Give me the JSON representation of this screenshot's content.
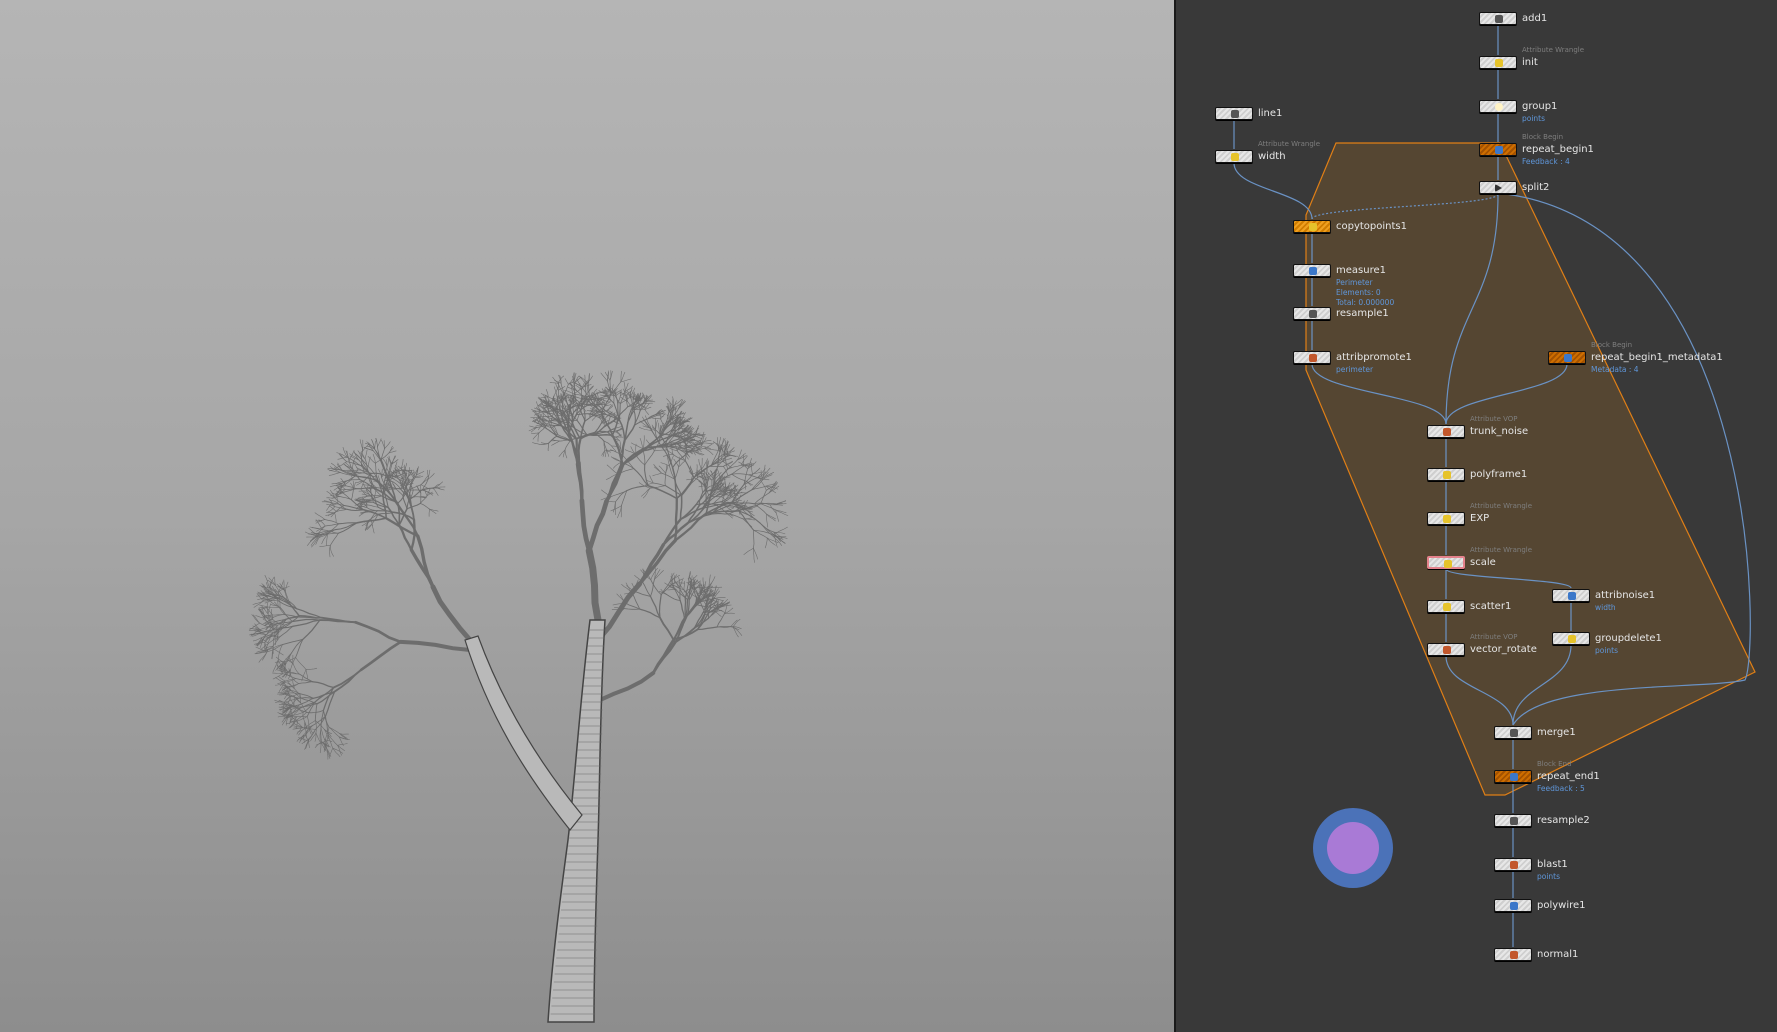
{
  "network": {
    "nodes": [
      {
        "id": "add1",
        "label": "add1",
        "glyph": "white-line"
      },
      {
        "id": "init",
        "label": "init",
        "type": "Attribute Wrangle",
        "glyph": "yellow"
      },
      {
        "id": "group1",
        "label": "group1",
        "info": "points",
        "glyph": "white"
      },
      {
        "id": "repeat_begin1",
        "label": "repeat_begin1",
        "type": "Block Begin",
        "info": "Feedback : 4",
        "glyph": "blue"
      },
      {
        "id": "split2",
        "label": "split2",
        "glyph": "tri"
      },
      {
        "id": "line1",
        "label": "line1",
        "glyph": "line"
      },
      {
        "id": "width",
        "label": "width",
        "type": "Attribute Wrangle",
        "glyph": "yellow"
      },
      {
        "id": "copytopoints1",
        "label": "copytopoints1",
        "glyph": "orange"
      },
      {
        "id": "measure1",
        "label": "measure1",
        "info": "Perimeter\nElements: 0\nTotal: 0.000000",
        "glyph": "measure"
      },
      {
        "id": "resample1",
        "label": "resample1",
        "glyph": "resample"
      },
      {
        "id": "attribpromote1",
        "label": "attribpromote1",
        "info": "perimeter",
        "glyph": "red"
      },
      {
        "id": "repeat_begin1_metadata1",
        "label": "repeat_begin1_metadata1",
        "type": "Block Begin",
        "info": "Metadata : 4",
        "glyph": "blue"
      },
      {
        "id": "trunk_noise",
        "label": "trunk_noise",
        "type": "Attribute VOP",
        "glyph": "vop"
      },
      {
        "id": "polyframe1",
        "label": "polyframe1",
        "glyph": "yellow"
      },
      {
        "id": "EXP",
        "label": "EXP",
        "type": "Attribute Wrangle",
        "glyph": "yellow"
      },
      {
        "id": "scale",
        "label": "scale",
        "type": "Attribute Wrangle",
        "glyph": "yellow"
      },
      {
        "id": "scatter1",
        "label": "scatter1",
        "glyph": "scatter"
      },
      {
        "id": "vector_rotate",
        "label": "vector_rotate",
        "type": "Attribute VOP",
        "glyph": "vop"
      },
      {
        "id": "attribnoise1",
        "label": "attribnoise1",
        "info": "width",
        "glyph": "noise"
      },
      {
        "id": "groupdelete1",
        "label": "groupdelete1",
        "info": "points",
        "glyph": "yellow"
      },
      {
        "id": "merge1",
        "label": "merge1",
        "glyph": "merge"
      },
      {
        "id": "repeat_end1",
        "label": "repeat_end1",
        "type": "Block End",
        "info": "Feedback : 5",
        "glyph": "blue"
      },
      {
        "id": "resample2",
        "label": "resample2",
        "glyph": "resample"
      },
      {
        "id": "blast1",
        "label": "blast1",
        "info": "points",
        "glyph": "red"
      },
      {
        "id": "polywire1",
        "label": "polywire1",
        "glyph": "blue"
      },
      {
        "id": "normal1",
        "label": "normal1",
        "glyph": "red"
      }
    ]
  },
  "colors": {
    "viewport_bg": "#a8a8a8",
    "network_bg": "#393939",
    "block_border": "#e07f16",
    "block_fill": "#5e4b30",
    "wire": "#6a92c4",
    "info_text": "#5f96d9",
    "display_flag": "#4b72b8",
    "render_flag": "#a97ad6"
  }
}
